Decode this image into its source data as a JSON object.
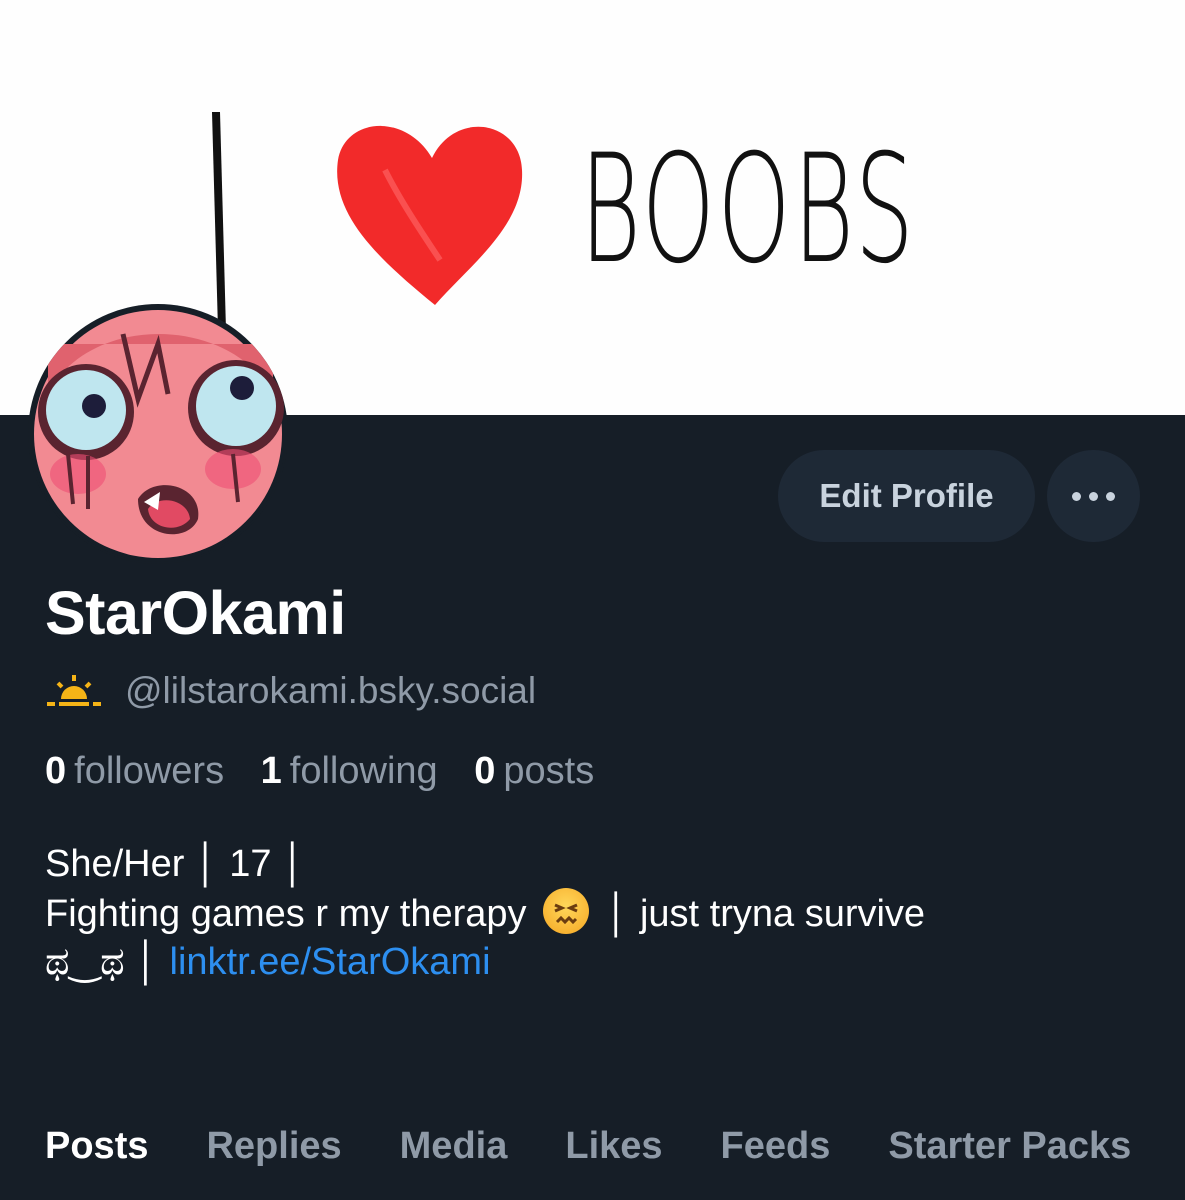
{
  "banner": {
    "text": "BOOBS"
  },
  "profile": {
    "display_name": "StarOkami",
    "handle": "@lilstarokami.bsky.social",
    "followers_count": "0",
    "followers_label": "followers",
    "following_count": "1",
    "following_label": "following",
    "posts_count": "0",
    "posts_label": "posts"
  },
  "actions": {
    "edit_label": "Edit Profile"
  },
  "bio": {
    "line1": "She/Her │ 17 │",
    "line2_a": "Fighting games r my therapy",
    "line2_b": "│ just tryna survive",
    "line3_a": "ಥ‿ಥ │ ",
    "link": "linktr.ee/StarOkami"
  },
  "tabs": [
    {
      "label": "Posts",
      "active": true
    },
    {
      "label": "Replies"
    },
    {
      "label": "Media"
    },
    {
      "label": "Likes"
    },
    {
      "label": "Feeds"
    },
    {
      "label": "Starter Packs"
    }
  ],
  "icons": {
    "handle_badge": "sunrise-icon",
    "more": "ellipsis-icon"
  },
  "colors": {
    "background": "#161e27",
    "accent_link": "#2d8ff0",
    "muted": "#8f9aa7"
  }
}
